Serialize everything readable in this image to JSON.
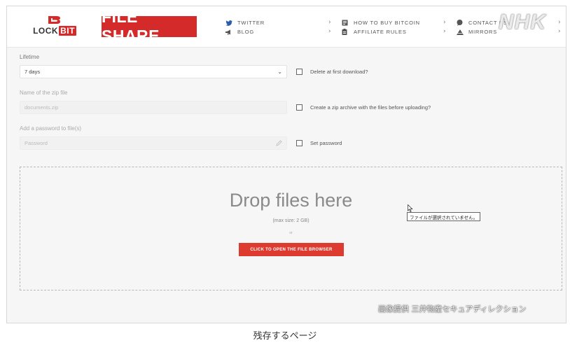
{
  "header": {
    "logo_text_a": "LOCK",
    "logo_text_b": "BIT",
    "fileshare_label": "FILE SHARE",
    "watermark": "NHK",
    "nav": {
      "col1": [
        {
          "label": "TWITTER",
          "icon": "twitter-icon"
        },
        {
          "label": "BLOG",
          "icon": "megaphone-icon"
        }
      ],
      "col2": [
        {
          "label": "HOW TO BUY BITCOIN",
          "icon": "document-icon"
        },
        {
          "label": "AFFILIATE RULES",
          "icon": "clipboard-icon"
        }
      ],
      "col3": [
        {
          "label": "CONTACT US",
          "icon": "chat-icon"
        },
        {
          "label": "MIRRORS",
          "icon": "pyramid-icon"
        }
      ]
    }
  },
  "form": {
    "lifetime_label": "Lifetime",
    "lifetime_value": "7 days",
    "delete_label": "Delete at first download?",
    "zip_name_label": "Name of the zip file",
    "zip_name_placeholder": "documents.zip",
    "zip_create_label": "Create a zip archive with the files before uploading?",
    "password_label": "Add a password to file(s)",
    "password_placeholder": "Password",
    "set_password_label": "Set password"
  },
  "dropzone": {
    "title": "Drop files here",
    "max_size": "(max size: 2 GB)",
    "or": "or",
    "browse_label": "CLICK TO OPEN THE FILE BROWSER",
    "tooltip": "ファイルが選択されていません。"
  },
  "overlay": {
    "credit": "画像提供 三井物産セキュアディレクション"
  },
  "caption": "残存するページ",
  "colors": {
    "brand_red": "#d42a2a",
    "button_red": "#de3b30",
    "background": "#f6f6f6"
  }
}
